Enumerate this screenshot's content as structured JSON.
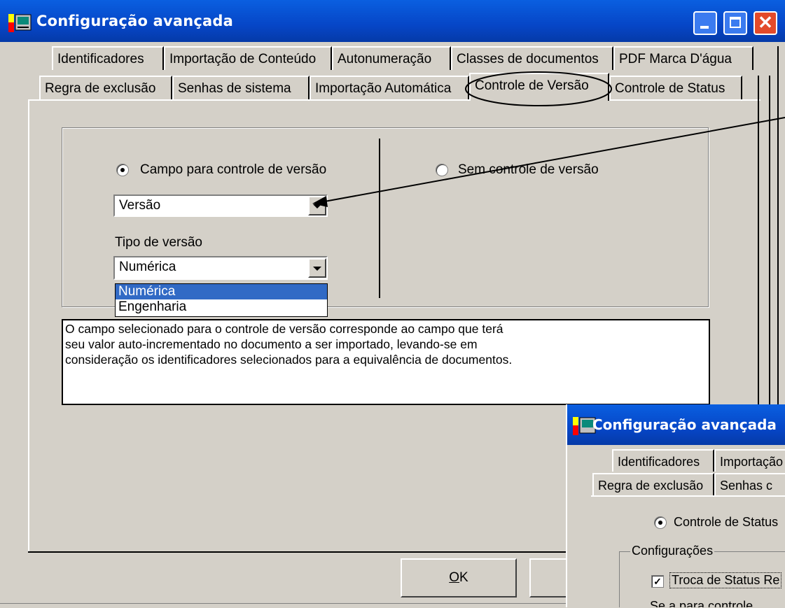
{
  "window": {
    "title": "Configuração avançada"
  },
  "tabs_row1": [
    {
      "label": "Identificadores"
    },
    {
      "label": "Importação de Conteúdo"
    },
    {
      "label": "Autonumeração"
    },
    {
      "label": "Classes de documentos"
    },
    {
      "label": "PDF Marca D'água"
    }
  ],
  "tabs_row2": [
    {
      "label": "Regra de exclusão"
    },
    {
      "label": "Senhas de sistema"
    },
    {
      "label": "Importação Automática"
    },
    {
      "label": "Controle de Versão",
      "selected": true
    },
    {
      "label": "Controle de Status"
    }
  ],
  "versioning": {
    "option_field_label": "Campo para controle de versão",
    "option_field_selected": true,
    "option_none_label": "Sem controle de versão",
    "field_combo_value": "Versão",
    "type_label": "Tipo de versão",
    "type_combo_value": "Numérica",
    "type_options": [
      "Numérica",
      "Engenharia"
    ],
    "type_highlighted": "Numérica"
  },
  "description": {
    "line1": "O campo selecionado para o controle de versão corresponde ao campo que terá",
    "line2": "seu valor auto-incrementado no documento a ser importado, levando-se em",
    "line3": "consideração os identificadores selecionados para a equivalência de documentos."
  },
  "buttons": {
    "ok_label": "OK",
    "ok_mnemonic": "O"
  },
  "inset_window": {
    "title": "Configuração avançada",
    "tab_row1": [
      "Identificadores",
      "Importação"
    ],
    "tab_row2": [
      "Regra de exclusão",
      "Senhas c"
    ],
    "status_radio_label": "Controle de Status",
    "group_label": "Configurações",
    "checkbox_label": "Troca de Status Re",
    "partial_text": "Se  a  para controle"
  },
  "colors": {
    "titlebar": "#0a5fe0",
    "face": "#d4d0c8",
    "highlight": "#316ac5",
    "close": "#e34a2a"
  }
}
